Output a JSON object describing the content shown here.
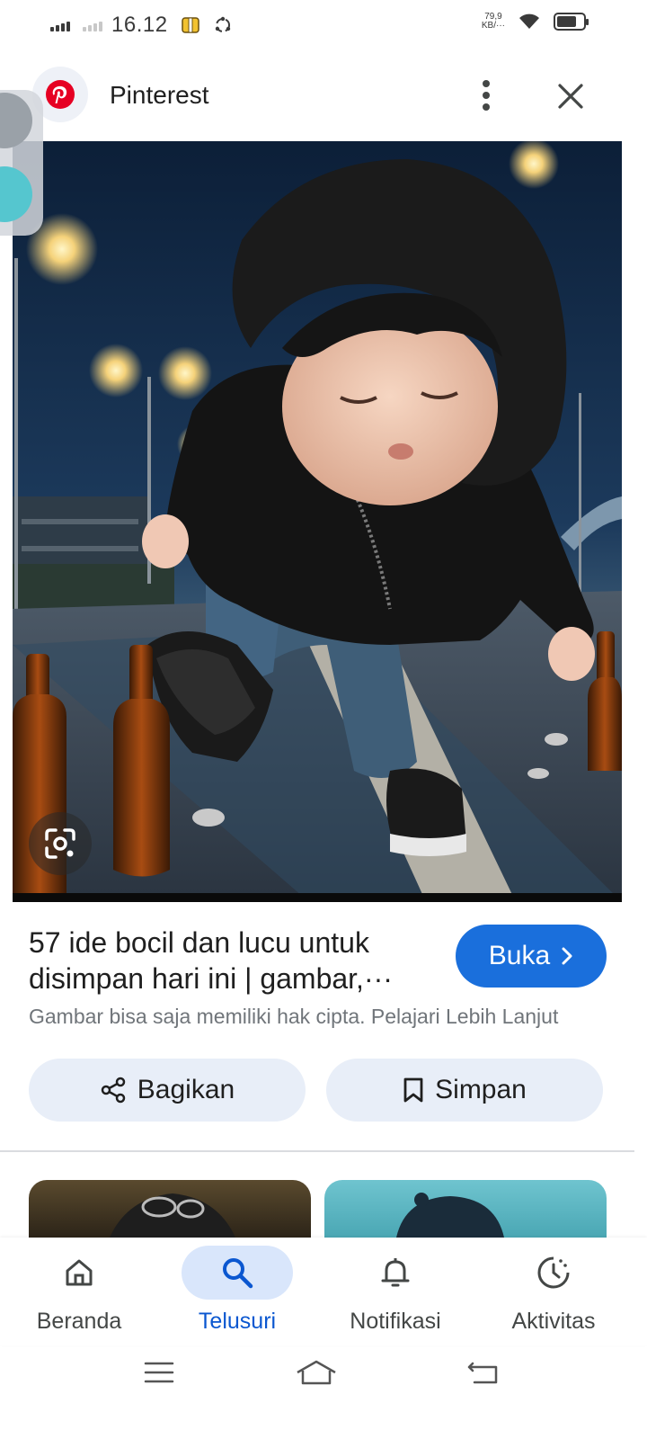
{
  "status_bar": {
    "time": "16.12",
    "net_speed_value": "79,9",
    "net_speed_unit": "KB/···",
    "battery_level": 0.75
  },
  "header": {
    "site_name": "Pinterest"
  },
  "result": {
    "title": "57 ide bocil dan lucu untuk disimpan hari ini | gambar,···",
    "open_label": "Buka",
    "copyright_notice": "Gambar bisa saja memiliki hak cipta. Pelajari Lebih Lanjut"
  },
  "actions": {
    "share_label": "Bagikan",
    "save_label": "Simpan"
  },
  "bottom_nav": {
    "items": [
      {
        "label": "Beranda",
        "icon": "home-icon",
        "active": false
      },
      {
        "label": "Telusuri",
        "icon": "search-icon",
        "active": true
      },
      {
        "label": "Notifikasi",
        "icon": "bell-icon",
        "active": false
      },
      {
        "label": "Aktivitas",
        "icon": "activity-icon",
        "active": false
      }
    ]
  },
  "colors": {
    "primary": "#1a6fdc",
    "active_nav": "#0b57d0",
    "active_nav_bg": "#d9e6fb",
    "action_bg": "#e8eef8",
    "pinterest_red": "#e60023"
  }
}
